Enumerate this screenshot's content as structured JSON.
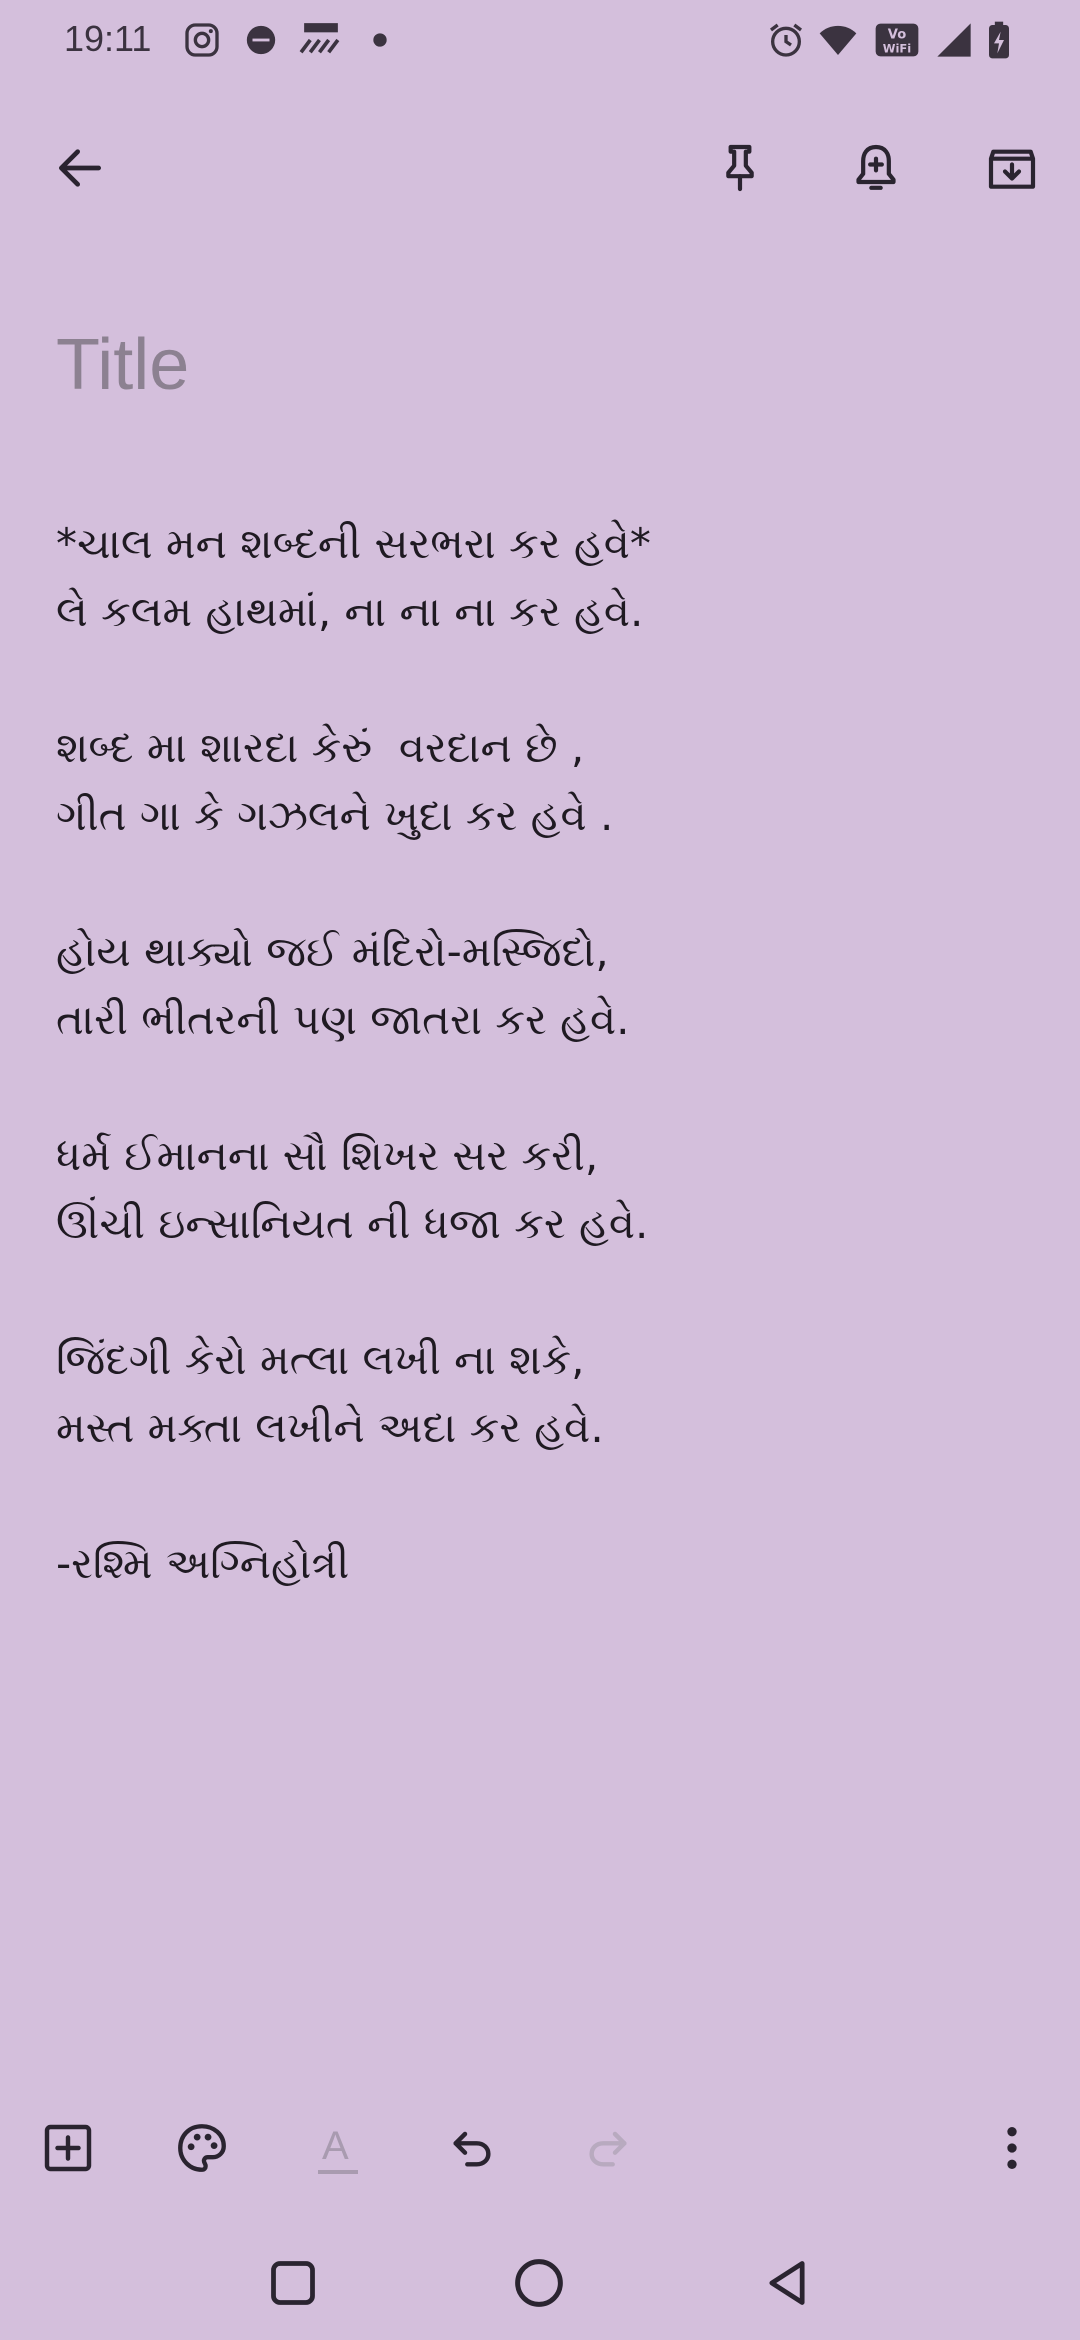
{
  "status_bar": {
    "time": "19:11",
    "icons": [
      "instagram-icon",
      "zee-app-icon",
      "cars24-icon",
      "dot-icon",
      "alarm-icon",
      "wifi-icon",
      "vowifi-icon",
      "signal-icon",
      "battery-charging-icon"
    ]
  },
  "app_bar": {
    "icons": [
      "back-arrow-icon",
      "pin-icon",
      "reminder-bell-icon",
      "archive-icon"
    ]
  },
  "note": {
    "title_value": "",
    "title_placeholder": "Title",
    "body": "*ચાલ મન શબ્દની સરભરા કર હવે*\nલે કલમ હાથમાં, ના ના ના કર હવે.\n\nશબ્દ મા શારદા કેરું  વરદાન છે ,\nગીત ગા કે ગઝલને ખુદા કર હવે .\n\nહોય થાક્યો જઈ મંદિરો-મસ્જિદો,\nતારી ભીતરની પણ જાતરા કર હવે.\n\nધર્મ ઈમાનના સૌ શિખર સર કરી,\nઊંચી ઇન્સાનિયત ની ધજા કર હવે.\n\nજિંદગી કેરો મત્લા લખી ના શકે,\nમસ્ત મક્તા લખીને અદા કર હવે.\n\n-રશ્મિ અગ્નિહોત્રી"
  },
  "bottom_toolbar": {
    "icons": [
      "add-box-icon",
      "palette-icon",
      "text-format-icon",
      "undo-icon",
      "redo-icon",
      "more-vert-icon"
    ],
    "text_format_glyph": "A"
  },
  "nav_bar": {
    "icons": [
      "recents-square-icon",
      "home-circle-icon",
      "back-triangle-icon"
    ]
  },
  "colors": {
    "background": "#d4bfdc",
    "icon": "#2a2430",
    "disabled_icon": "#a99bb0",
    "title_placeholder": "#8c8191"
  }
}
